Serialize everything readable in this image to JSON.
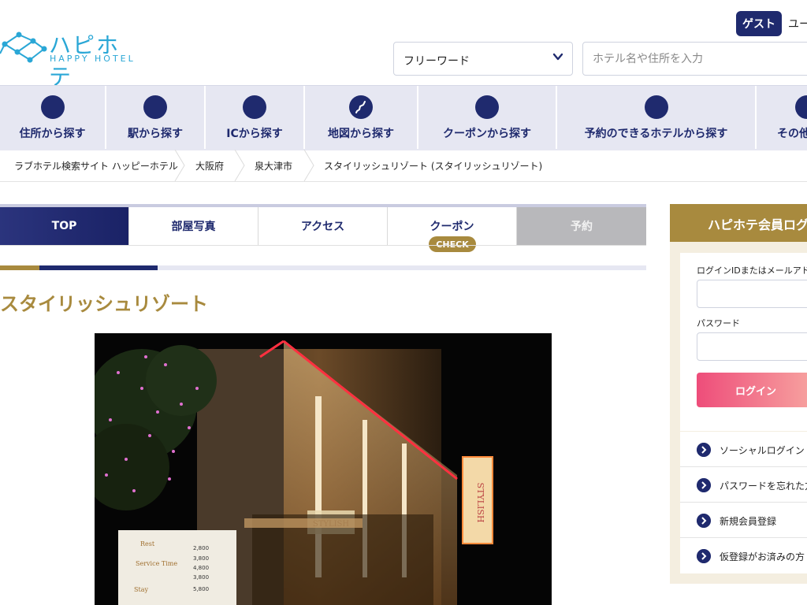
{
  "header": {
    "logo_jp": "ハピホテ",
    "logo_en": "HAPPY HOTEL",
    "guest_label": "ゲスト",
    "user_label": "ユー",
    "select_value": "フリーワード",
    "search_placeholder": "ホテル名や住所を入力"
  },
  "nav": {
    "items": [
      {
        "label": "住所から探す"
      },
      {
        "label": "駅から探す"
      },
      {
        "label": "ICから探す"
      },
      {
        "label": "地図から探す"
      },
      {
        "label": "クーポンから探す"
      },
      {
        "label": "予約のできるホテルから探す"
      },
      {
        "label": "その他"
      }
    ]
  },
  "breadcrumb": [
    "ラブホテル検索サイト ハッピーホテル",
    "大阪府",
    "泉大津市",
    "スタイリッシュリゾート (スタイリッシュリゾート)"
  ],
  "tabs": [
    {
      "label": "TOP"
    },
    {
      "label": "部屋写真"
    },
    {
      "label": "アクセス"
    },
    {
      "label": "クーポン"
    },
    {
      "label": "予約"
    }
  ],
  "check_badge": "CHECK",
  "hotel_title": "スタイリッシュリゾート",
  "login": {
    "title": "ハピホテ会員ログ",
    "id_label": "ログインIDまたはメールアドレ",
    "password_label": "パスワード",
    "button": "ログイン",
    "links": [
      {
        "label": "ソーシャルログイン"
      },
      {
        "label": "パスワードを忘れた方"
      },
      {
        "label": "新規会員登録"
      },
      {
        "label": "仮登録がお済みの方"
      }
    ]
  },
  "photo": {
    "sign_text": "STYLISH",
    "price_labels": [
      "Rest",
      "Service Time",
      "Stay"
    ],
    "prices": [
      "2,800",
      "3,800",
      "4,800",
      "3,800",
      "5,800"
    ]
  },
  "colors": {
    "navy": "#1f2a6e",
    "gold": "#a88a3e",
    "nav_bg": "#e6e7f2",
    "logo_blue": "#2aa7d6",
    "login_pink": "#ee4d7a"
  }
}
